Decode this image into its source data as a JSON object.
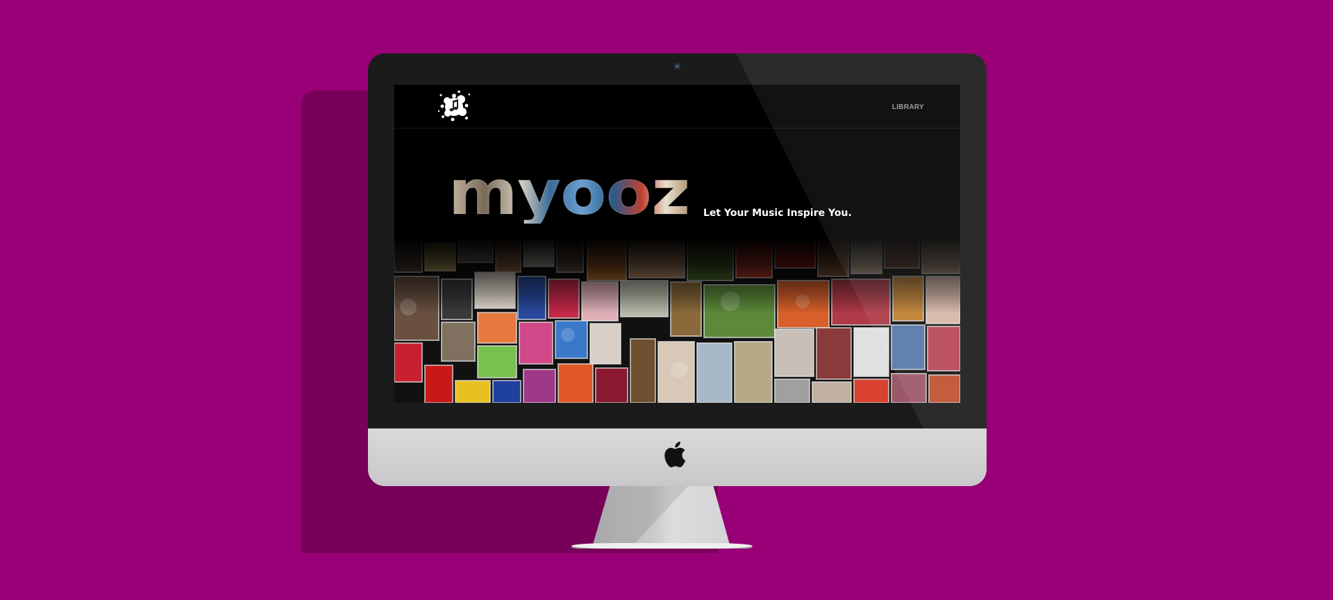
{
  "site": {
    "brand": "myooz",
    "tagline": "Let Your Music Inspire You.",
    "nav": {
      "library_label": "LIBRARY"
    }
  },
  "icons": {
    "logo": "paint-splatter-music-note-icon",
    "camera": "webcam-icon",
    "manufacturer": "apple-logo-icon"
  },
  "colors": {
    "background": "#990077",
    "shadow": "#770058",
    "bezel": "#1b1b1b",
    "chin": "#d0d0d2",
    "screen": "#000000",
    "tagline": "#ffffff",
    "nav": "#9a9a9a"
  }
}
